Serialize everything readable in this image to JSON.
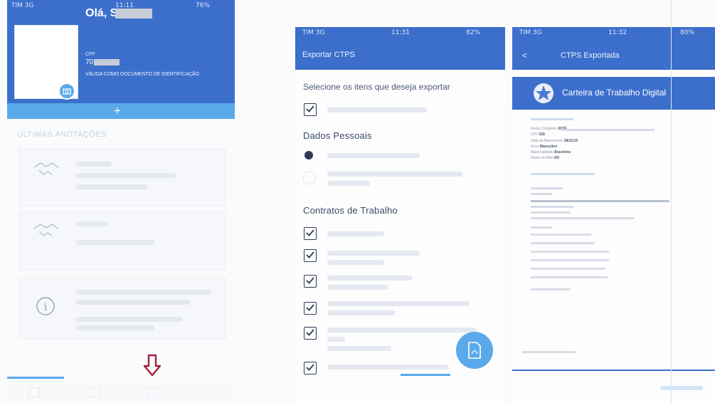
{
  "screen1": {
    "status": {
      "carrier": "TIM 3G",
      "time": "11:11",
      "battery": "76%"
    },
    "greeting": "Olá, S",
    "cpf_label": "CPF",
    "cpf_value": "70",
    "id_notice": "VÁLIDA COMO DOCUMENTO DE IDENTIFICAÇÃO",
    "expand_symbol": "+",
    "section_title": "ÚLTIMAS ANOTAÇÕES"
  },
  "screen2": {
    "status": {
      "carrier": "TIM 3G",
      "time": "11:31",
      "battery": "82%"
    },
    "title": "Exportar CTPS",
    "prompt": "Selecione os itens que deseja exportar",
    "personal_heading": "Dados Pessoais",
    "contracts_heading": "Contratos de Trabalho"
  },
  "screen3": {
    "status": {
      "carrier": "TIM 3G",
      "time": "11:32",
      "battery": "80%"
    },
    "back_symbol": "<",
    "title": "CTPS Exportada",
    "doc_header": "Carteira de Trabalho Digital",
    "doc_fields": [
      {
        "label": "Nome Completo",
        "value": "JOSÉ"
      },
      {
        "label": "CPF",
        "value": "318"
      },
      {
        "label": "Data de Nascimento",
        "value": "28/11/19"
      },
      {
        "label": "Sexo",
        "value": "Masculino"
      },
      {
        "label": "Nacionalidade",
        "value": "Brasileira"
      },
      {
        "label": "Nome da Mãe",
        "value": "AD"
      }
    ]
  },
  "colors": {
    "header_blue": "#3c6fcc",
    "accent_blue": "#5aa9ea",
    "arrow_red": "#a1203c"
  },
  "icons": [
    "handshake-icon",
    "info-icon",
    "down-arrow-icon",
    "pdf-icon",
    "coat-of-arms-icon",
    "checkbox-checked-icon",
    "radio-selected-icon",
    "radio-empty-icon"
  ]
}
